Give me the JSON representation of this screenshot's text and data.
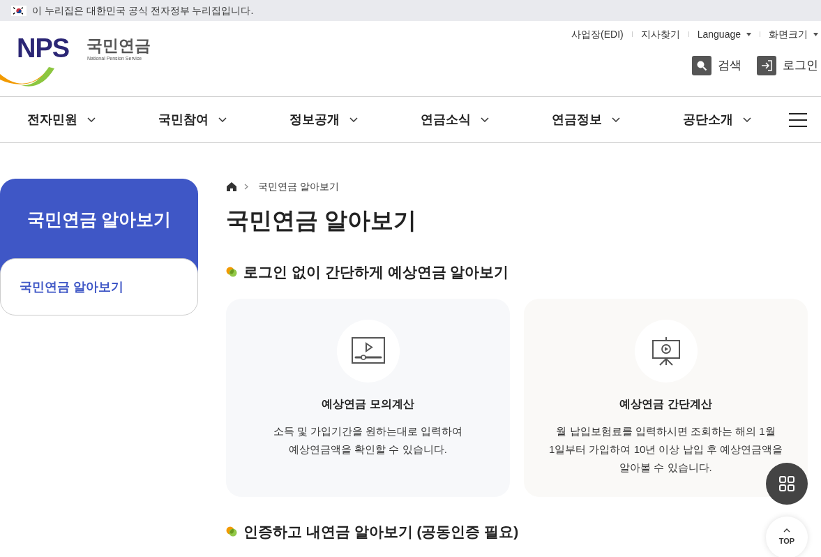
{
  "gov_banner": {
    "text": "이 누리집은 대한민국 공식 전자정부 누리집입니다."
  },
  "logo": {
    "mark": "NPS",
    "name": "국민연금",
    "subtitle": "National Pension Service"
  },
  "utility_links": [
    {
      "label": "사업장(EDI)",
      "kind": "link"
    },
    {
      "label": "지사찾기",
      "kind": "link"
    },
    {
      "label": "Language",
      "kind": "dropdown"
    },
    {
      "label": "화면크기",
      "kind": "dropdown"
    }
  ],
  "header_buttons": [
    {
      "label": "검색",
      "kind": "search"
    },
    {
      "label": "로그인",
      "kind": "login"
    }
  ],
  "nav": [
    "전자민원",
    "국민참여",
    "정보공개",
    "연금소식",
    "연금정보",
    "공단소개"
  ],
  "sidebar": {
    "title": "국민연금 알아보기",
    "items": [
      {
        "label": "국민연금 알아보기",
        "selected": true
      }
    ]
  },
  "breadcrumb": [
    "국민연금 알아보기"
  ],
  "page_title": "국민연금 알아보기",
  "sections": [
    {
      "heading": "로그인 없이 간단하게 예상연금 알아보기",
      "cards": [
        {
          "kind": "video",
          "title": "예상연금 모의계산",
          "lines": [
            "소득 및 가입기간을 원하는대로 입력하여",
            "예상연금액을 확인할 수 있습니다."
          ]
        },
        {
          "kind": "presentation",
          "title": "예상연금 간단계산",
          "lines": [
            "월 납입보험료를 입력하시면 조회하는 해의 1월",
            "1일부터 가입하여 10년 이상 납입 후 예상연금액을",
            "알아볼 수 있습니다."
          ]
        }
      ]
    },
    {
      "heading": "인증하고 내연금 알아보기 (공동인증 필요)"
    }
  ],
  "floating": {
    "top_label": "TOP"
  }
}
